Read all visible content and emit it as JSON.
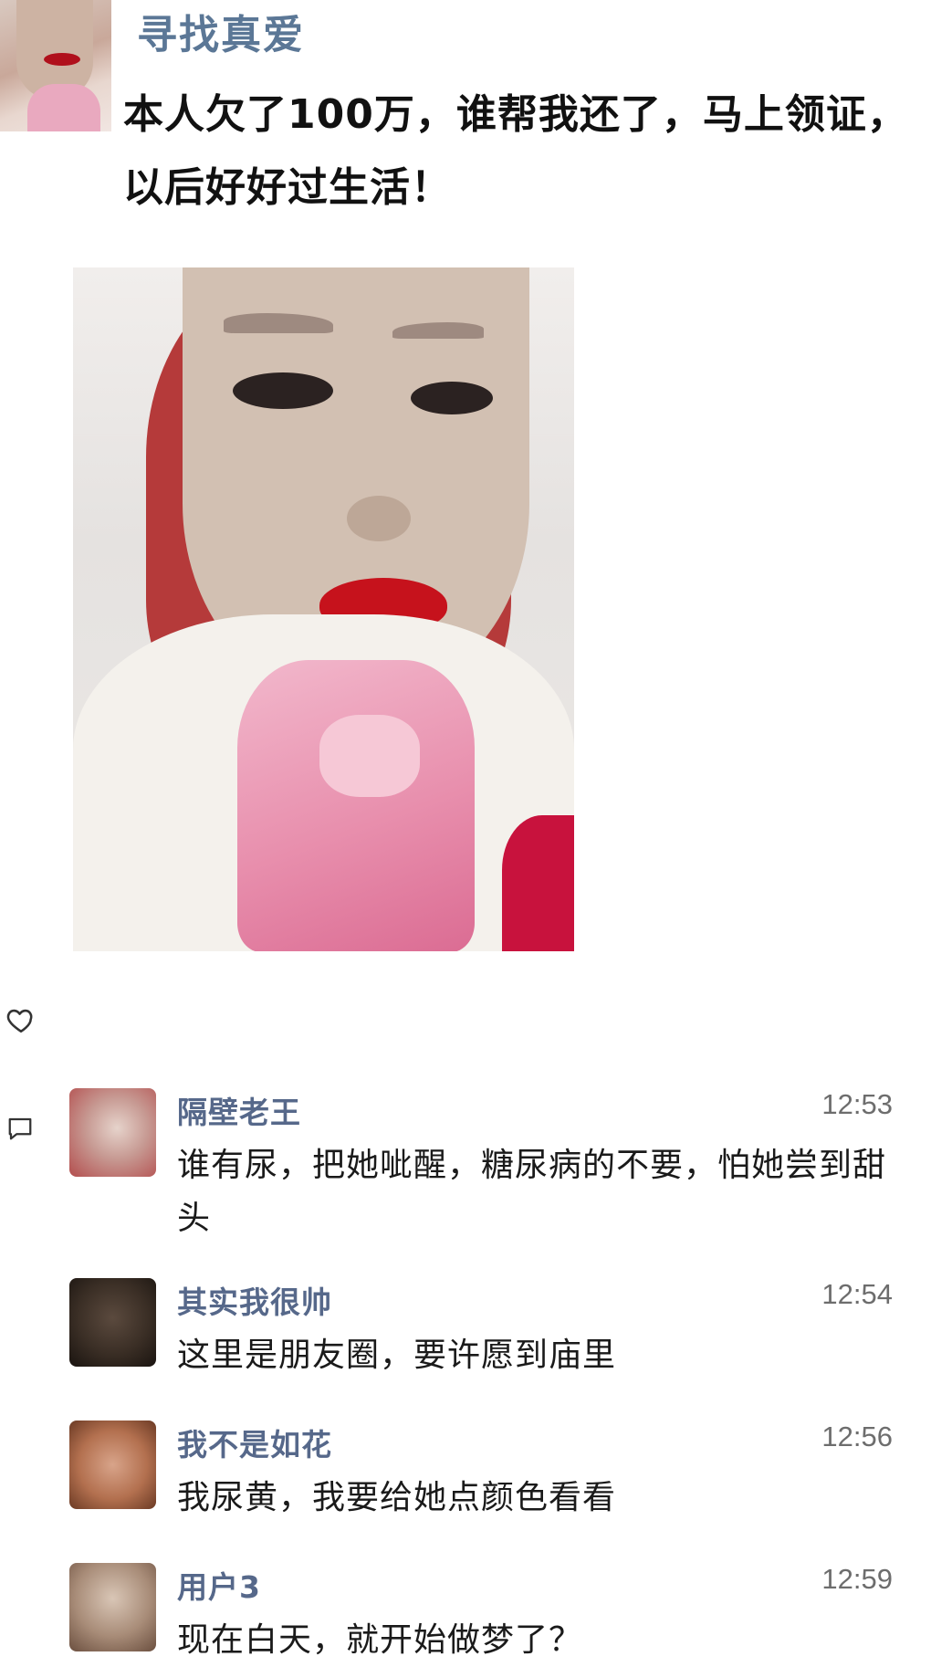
{
  "post": {
    "author": "寻找真爱",
    "text": "本人欠了100万，谁帮我还了，马上领证，以后好好过生活！"
  },
  "comments": [
    {
      "name": "隔壁老王",
      "time": "12:53",
      "text": "谁有尿，把她呲醒，糖尿病的不要，怕她尝到甜头"
    },
    {
      "name": "其实我很帅",
      "time": "12:54",
      "text": "这里是朋友圈，要许愿到庙里"
    },
    {
      "name": "我不是如花",
      "time": "12:56",
      "text": "我尿黄，我要给她点颜色看看"
    },
    {
      "name": "用户3",
      "time": "12:59",
      "text": "现在白天，就开始做梦了？"
    }
  ],
  "colors": {
    "author_name": "#5b7796",
    "comment_name": "#56688a",
    "timestamp": "#6d6d6d"
  }
}
